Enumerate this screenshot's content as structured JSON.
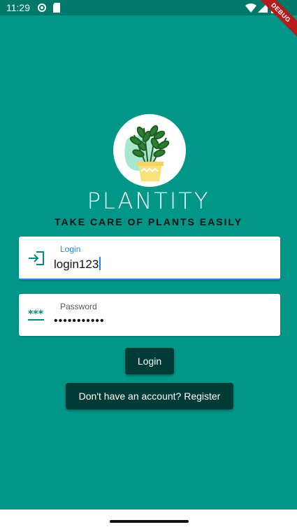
{
  "status_bar": {
    "time": "11:29"
  },
  "debug_banner": "DEBUG",
  "brand": {
    "name": "PLANTITY",
    "tagline": "TAKE CARE OF PLANTS EASILY"
  },
  "login_field": {
    "label": "Login",
    "value": "login123",
    "icon": "login-icon"
  },
  "password_field": {
    "label": "Password",
    "value": "•••••••••••",
    "icon": "password-icon"
  },
  "buttons": {
    "login": "Login",
    "register": "Don't have an account? Register"
  },
  "colors": {
    "background": "#009688",
    "status_bar": "#00796b",
    "button": "#003c35",
    "accent": "#1e88e5"
  }
}
